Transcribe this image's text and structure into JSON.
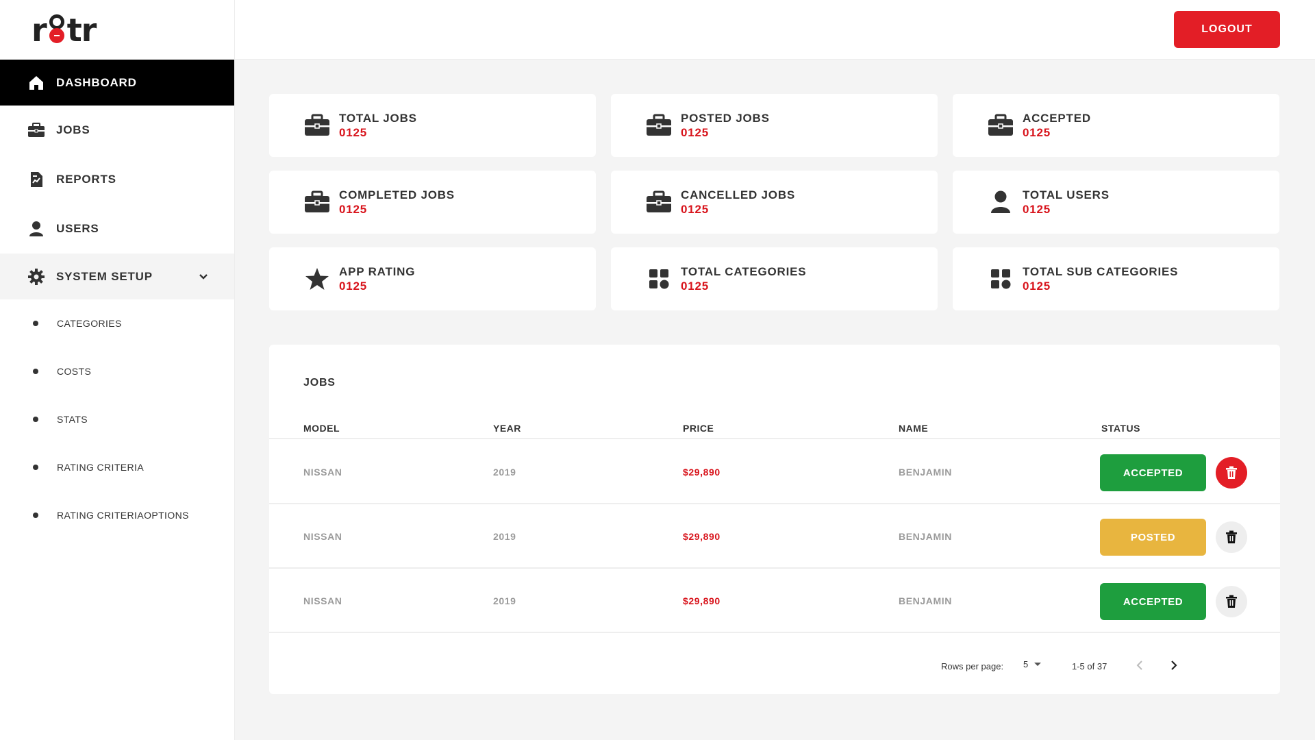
{
  "brand": {
    "logo_left": "r",
    "logo_right": "tr"
  },
  "header": {
    "logout_label": "LOGOUT"
  },
  "sidebar": {
    "items": [
      {
        "label": "DASHBOARD",
        "icon": "home-icon",
        "active": true
      },
      {
        "label": "JOBS",
        "icon": "briefcase-icon"
      },
      {
        "label": "REPORTS",
        "icon": "report-icon"
      },
      {
        "label": "USERS",
        "icon": "user-icon"
      },
      {
        "label": "SYSTEM SETUP",
        "icon": "gear-icon",
        "expanded": true
      }
    ],
    "sub_items": [
      {
        "label": "CATEGORIES"
      },
      {
        "label": "COSTS"
      },
      {
        "label": "STATS"
      },
      {
        "label": "RATING CRITERIA"
      },
      {
        "label": "RATING CRITERIAOPTIONS"
      }
    ]
  },
  "cards": [
    {
      "label": "TOTAL JOBS",
      "value": "0125",
      "icon": "briefcase-icon"
    },
    {
      "label": "POSTED JOBS",
      "value": "0125",
      "icon": "briefcase-icon"
    },
    {
      "label": "ACCEPTED",
      "value": "0125",
      "icon": "briefcase-icon"
    },
    {
      "label": "COMPLETED JOBS",
      "value": "0125",
      "icon": "briefcase-icon"
    },
    {
      "label": "CANCELLED JOBS",
      "value": "0125",
      "icon": "briefcase-icon"
    },
    {
      "label": "TOTAL USERS",
      "value": "0125",
      "icon": "user-icon"
    },
    {
      "label": "APP RATING",
      "value": "0125",
      "icon": "star-icon"
    },
    {
      "label": "TOTAL CATEGORIES",
      "value": "0125",
      "icon": "grid-icon"
    },
    {
      "label": "TOTAL SUB CATEGORIES",
      "value": "0125",
      "icon": "grid-icon"
    }
  ],
  "jobs": {
    "title": "JOBS",
    "columns": [
      "MODEL",
      "YEAR",
      "PRICE",
      "NAME",
      "STATUS"
    ],
    "rows": [
      {
        "model": "NISSAN",
        "year": "2019",
        "price": "$29,890",
        "name": "BENJAMIN",
        "status": "ACCEPTED",
        "status_color": "#1e9e3e",
        "delete_style": "red"
      },
      {
        "model": "NISSAN",
        "year": "2019",
        "price": "$29,890",
        "name": "BENJAMIN",
        "status": "POSTED",
        "status_color": "#e8b53f",
        "delete_style": "grey"
      },
      {
        "model": "NISSAN",
        "year": "2019",
        "price": "$29,890",
        "name": "BENJAMIN",
        "status": "ACCEPTED",
        "status_color": "#1e9e3e",
        "delete_style": "grey"
      }
    ]
  },
  "pagination": {
    "rows_per_page_label": "Rows per page:",
    "rows_per_page": "5",
    "range": "1-5 of 37"
  },
  "colors": {
    "accent": "#e31e26",
    "accepted": "#1e9e3e",
    "posted": "#e8b53f",
    "value_red": "#d8141c"
  }
}
